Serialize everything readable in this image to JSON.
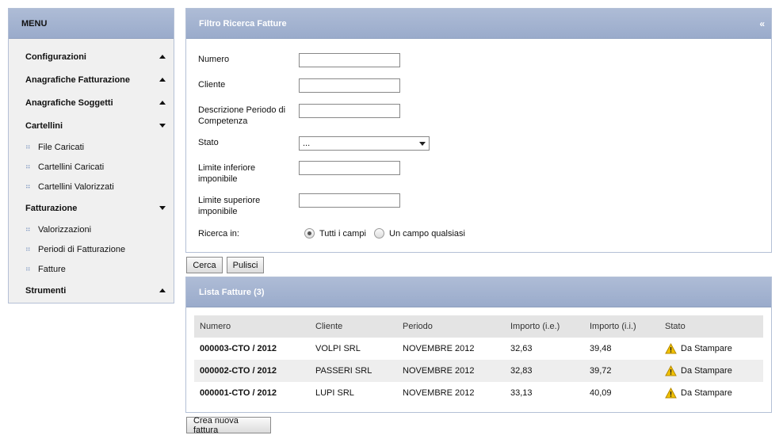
{
  "menu": {
    "title": "MENU",
    "sections": [
      {
        "label": "Configurazioni",
        "state": "collapsed",
        "items": []
      },
      {
        "label": "Anagrafiche Fatturazione",
        "state": "collapsed",
        "items": []
      },
      {
        "label": "Anagrafiche Soggetti",
        "state": "collapsed",
        "items": []
      },
      {
        "label": "Cartellini",
        "state": "expanded",
        "items": [
          "File Caricati",
          "Cartellini Caricati",
          "Cartellini Valorizzati"
        ]
      },
      {
        "label": "Fatturazione",
        "state": "expanded",
        "items": [
          "Valorizzazioni",
          "Periodi di Fatturazione",
          "Fatture"
        ]
      },
      {
        "label": "Strumenti",
        "state": "collapsed",
        "items": []
      }
    ]
  },
  "filter": {
    "title": "Filtro Ricerca Fatture",
    "collapse_icon": "«",
    "numero_label": "Numero",
    "numero_value": "",
    "cliente_label": "Cliente",
    "cliente_value": "",
    "descrizione_label_1": "Descrizione Periodo di",
    "descrizione_label_2": "Competenza",
    "descrizione_value": "",
    "stato_label": "Stato",
    "stato_value": "...",
    "limite_inf_label_1": "Limite inferiore",
    "limite_inf_label_2": "imponibile",
    "limite_inf_value": "",
    "limite_sup_label_1": "Limite superiore",
    "limite_sup_label_2": "imponibile",
    "limite_sup_value": "",
    "ricerca_label": "Ricerca in:",
    "radio_all": "Tutti i campi",
    "radio_any": "Un campo qualsiasi",
    "radio_selected": "all"
  },
  "buttons": {
    "cerca": "Cerca",
    "pulisci": "Pulisci",
    "crea": "Crea nuova fattura"
  },
  "list": {
    "title": "Lista Fatture (3)",
    "columns": [
      "Numero",
      "Cliente",
      "Periodo",
      "Importo (i.e.)",
      "Importo (i.i.)",
      "Stato"
    ],
    "rows": [
      {
        "numero": "000003-CTO / 2012",
        "cliente": "VOLPI SRL",
        "periodo": "NOVEMBRE 2012",
        "importo_ie": "32,63",
        "importo_ii": "39,48",
        "stato": "Da Stampare"
      },
      {
        "numero": "000002-CTO / 2012",
        "cliente": "PASSERI SRL",
        "periodo": "NOVEMBRE 2012",
        "importo_ie": "32,83",
        "importo_ii": "39,72",
        "stato": "Da Stampare"
      },
      {
        "numero": "000001-CTO / 2012",
        "cliente": "LUPI SRL",
        "periodo": "NOVEMBRE 2012",
        "importo_ie": "33,13",
        "importo_ii": "40,09",
        "stato": "Da Stampare"
      }
    ]
  },
  "icons": {
    "warning": "warning-icon",
    "menu_item": "grip-dots-icon"
  },
  "colors": {
    "header": "#9fb0cf",
    "warning": "#f2c200"
  }
}
